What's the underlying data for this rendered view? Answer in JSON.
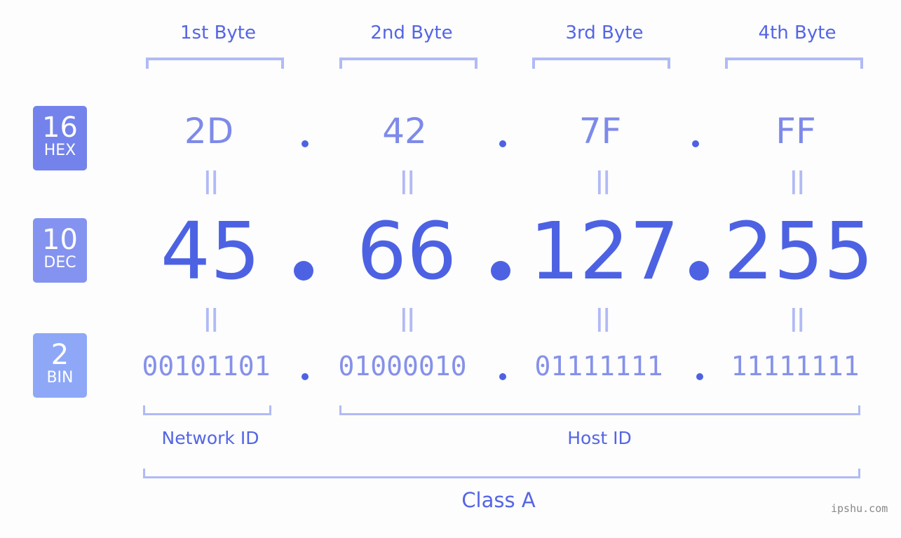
{
  "badges": [
    {
      "number": "16",
      "label": "HEX",
      "color": "#7383eb"
    },
    {
      "number": "10",
      "label": "DEC",
      "color": "#8493f0"
    },
    {
      "number": "2",
      "label": "BIN",
      "color": "#8ea8f7"
    }
  ],
  "bytes": [
    {
      "label": "1st Byte",
      "hex": "2D",
      "dec": "45",
      "bin": "00101101"
    },
    {
      "label": "2nd Byte",
      "hex": "42",
      "dec": "66",
      "bin": "01000010"
    },
    {
      "label": "3rd Byte",
      "hex": "7F",
      "dec": "127",
      "bin": "01111111"
    },
    {
      "label": "4th Byte",
      "hex": "FF",
      "dec": "255",
      "bin": "11111111"
    }
  ],
  "equals_symbol": "||",
  "network_id_label": "Network ID",
  "host_id_label": "Host ID",
  "class_label": "Class A",
  "watermark": "ipshu.com",
  "colors": {
    "accent": "#4d62e3",
    "bracket": "#b1baf6",
    "hex_text": "#7e8ae9",
    "bin_text": "#8691ea"
  }
}
